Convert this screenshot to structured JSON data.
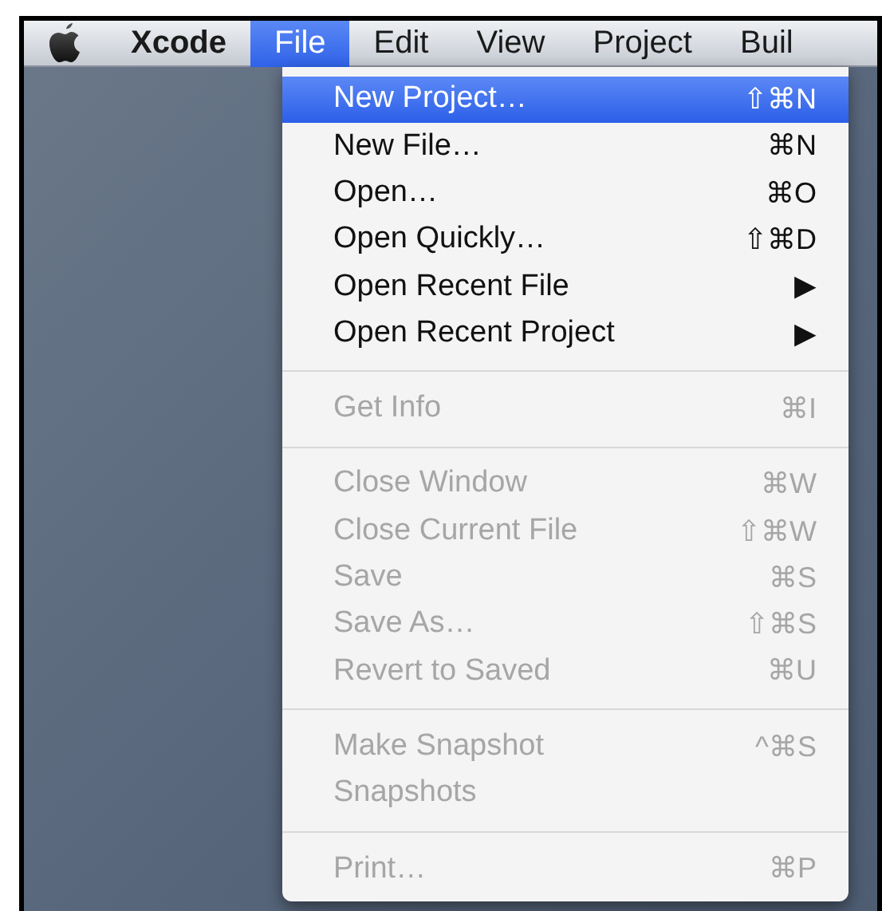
{
  "menu_bar": [
    {
      "label": "Xcode",
      "kind": "app",
      "selected": false
    },
    {
      "label": "File",
      "kind": "menu",
      "selected": true
    },
    {
      "label": "Edit",
      "kind": "menu",
      "selected": false
    },
    {
      "label": "View",
      "kind": "menu",
      "selected": false
    },
    {
      "label": "Project",
      "kind": "menu",
      "selected": false
    },
    {
      "label": "Buil",
      "kind": "menu",
      "selected": false
    }
  ],
  "menu": {
    "groups": [
      [
        {
          "label": "New Project…",
          "shortcut": "⇧⌘N",
          "selected": true,
          "disabled": false
        },
        {
          "label": "New File…",
          "shortcut": "⌘N",
          "selected": false,
          "disabled": false
        },
        {
          "label": "Open…",
          "shortcut": "⌘O",
          "selected": false,
          "disabled": false
        },
        {
          "label": "Open Quickly…",
          "shortcut": "⇧⌘D",
          "selected": false,
          "disabled": false
        },
        {
          "label": "Open Recent File",
          "shortcut": "▶",
          "selected": false,
          "disabled": false
        },
        {
          "label": "Open Recent Project",
          "shortcut": "▶",
          "selected": false,
          "disabled": false
        }
      ],
      [
        {
          "label": "Get Info",
          "shortcut": "⌘I",
          "selected": false,
          "disabled": true
        }
      ],
      [
        {
          "label": "Close Window",
          "shortcut": "⌘W",
          "selected": false,
          "disabled": true
        },
        {
          "label": "Close Current File",
          "shortcut": "⇧⌘W",
          "selected": false,
          "disabled": true
        },
        {
          "label": "Save",
          "shortcut": "⌘S",
          "selected": false,
          "disabled": true
        },
        {
          "label": "Save As…",
          "shortcut": "⇧⌘S",
          "selected": false,
          "disabled": true
        },
        {
          "label": "Revert to Saved",
          "shortcut": "⌘U",
          "selected": false,
          "disabled": true
        }
      ],
      [
        {
          "label": "Make Snapshot",
          "shortcut": "^⌘S",
          "selected": false,
          "disabled": true
        },
        {
          "label": "Snapshots",
          "selected": false,
          "disabled": true
        }
      ],
      [
        {
          "label": "Print…",
          "shortcut": "⌘P",
          "selected": false,
          "disabled": true
        }
      ]
    ]
  }
}
